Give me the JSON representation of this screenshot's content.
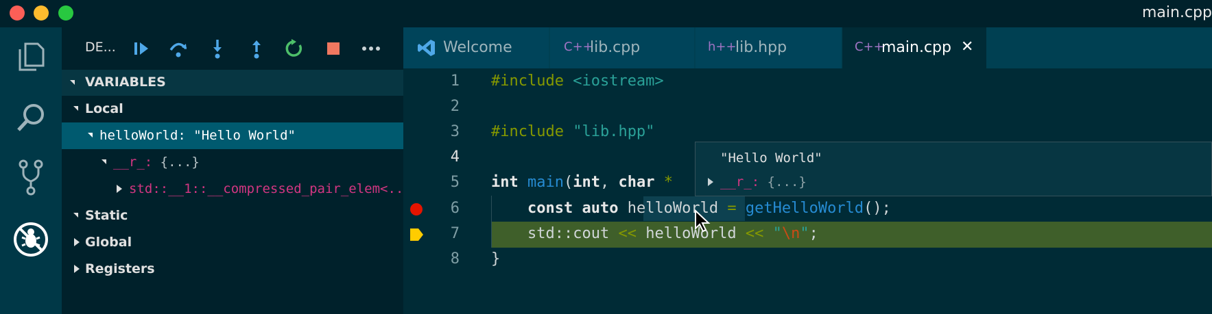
{
  "window": {
    "title": "main.cpp"
  },
  "activity_bar": {
    "items": [
      {
        "icon": "files-icon"
      },
      {
        "icon": "search-icon"
      },
      {
        "icon": "source-control-icon"
      },
      {
        "icon": "debug-icon"
      }
    ]
  },
  "debug_toolbar": {
    "config_label": "DE...",
    "buttons": [
      "continue",
      "step-over",
      "step-into",
      "step-out",
      "restart",
      "stop",
      "more"
    ]
  },
  "variables": {
    "header": "VARIABLES",
    "local_label": "Local",
    "selected_name": "helloWorld",
    "selected_value": "\"Hello World\"",
    "child_name": "__r_",
    "child_value": "{...}",
    "grandchild": "std::__1::__compressed_pair_elem<...",
    "static_label": "Static",
    "global_label": "Global",
    "registers_label": "Registers"
  },
  "tabs": [
    {
      "label": "Welcome",
      "icon": "vscode-icon"
    },
    {
      "label": "lib.cpp",
      "icon": "C++"
    },
    {
      "label": "lib.hpp",
      "icon": "h++"
    },
    {
      "label": "main.cpp",
      "icon": "C++",
      "active": true
    }
  ],
  "close_glyph": "✕",
  "editor": {
    "line_numbers": [
      "1",
      "2",
      "3",
      "4",
      "5",
      "6",
      "7",
      "8"
    ],
    "line1": {
      "directive": "#include",
      "header": "<iostream>"
    },
    "line3": {
      "directive": "#include",
      "header": "\"lib.hpp\""
    },
    "line5": {
      "t1": "int",
      "fn": "main",
      "p1": "(",
      "t2": "int",
      "sep": ", ",
      "t3": "char",
      "rest": " *"
    },
    "line6": {
      "k1": "const",
      "k2": "auto",
      "var": "helloWorld",
      "eq": "=",
      "call": "getHelloWorld",
      "tail": "();"
    },
    "line7": {
      "ns": "std::cout",
      "op1": "<<",
      "var": "helloWorld",
      "op2": "<<",
      "q1": "\"",
      "esc": "\\n",
      "q2": "\"",
      "semi": ";"
    },
    "line8": {
      "brace": "}"
    }
  },
  "hover": {
    "value": "\"Hello World\"",
    "child_name": "__r_",
    "child_value": "{...}"
  },
  "colors": {
    "breakpoint": "#e51400",
    "current_line_arrow": "#ffcc00",
    "current_line_bg": "#3f5f2a",
    "selected_row": "#005a6f"
  }
}
